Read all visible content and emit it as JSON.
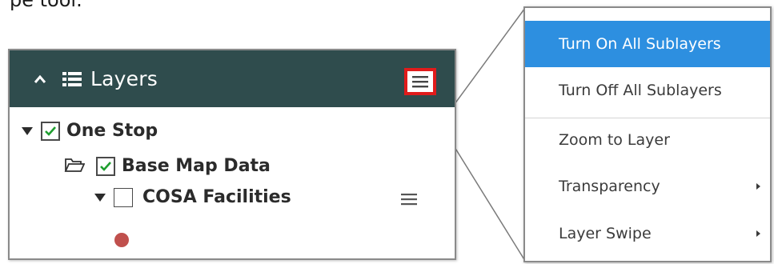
{
  "caption": "pe tool.",
  "layers_panel": {
    "title": "Layers",
    "tree": [
      {
        "label": "One Stop",
        "checked": true
      },
      {
        "label": "Base Map Data",
        "checked": true
      },
      {
        "label": "COSA Facilities",
        "checked": false
      }
    ],
    "legend_symbol_color": "#c0504d"
  },
  "context_menu": {
    "items": [
      {
        "label": "Turn On All Sublayers",
        "active": true,
        "submenu": false
      },
      {
        "label": "Turn Off All Sublayers",
        "active": false,
        "submenu": false
      },
      {
        "label": "Zoom to Layer",
        "active": false,
        "submenu": false
      },
      {
        "label": "Transparency",
        "active": false,
        "submenu": true
      },
      {
        "label": "Layer Swipe",
        "active": false,
        "submenu": true
      }
    ]
  },
  "colors": {
    "header_bg": "#2f4c4d",
    "highlight": "#e11b1b",
    "menu_active": "#2d8fe0",
    "checkmark": "#1e9e2f"
  }
}
